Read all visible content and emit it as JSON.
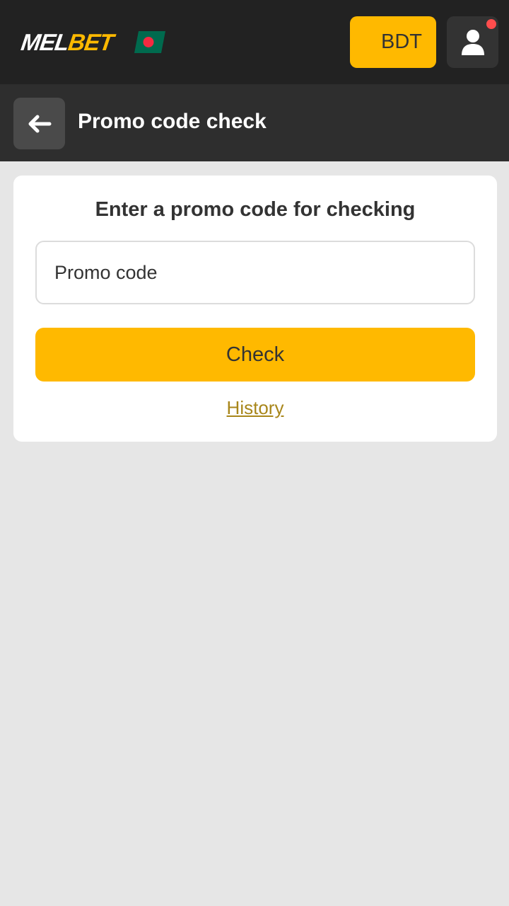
{
  "header": {
    "logo": {
      "part1": "MEL",
      "part2": "BET"
    },
    "flag_icon": "bangladesh-flag-icon",
    "currency_label": "BDT",
    "profile_icon": "user-icon",
    "has_notification": true
  },
  "subheader": {
    "back_icon": "arrow-left-icon",
    "title": "Promo code check"
  },
  "card": {
    "title": "Enter a promo code for checking",
    "input_value": "",
    "input_placeholder": "Promo code",
    "check_label": "Check",
    "history_label": "History"
  },
  "colors": {
    "accent": "#ffb900",
    "header_bg": "#222222",
    "subheader_bg": "#2e2e2e",
    "page_bg": "#e6e6e6",
    "link": "#a8861a",
    "notification": "#ff4d4d",
    "flag_green": "#006a4e",
    "flag_red": "#f42a41"
  }
}
